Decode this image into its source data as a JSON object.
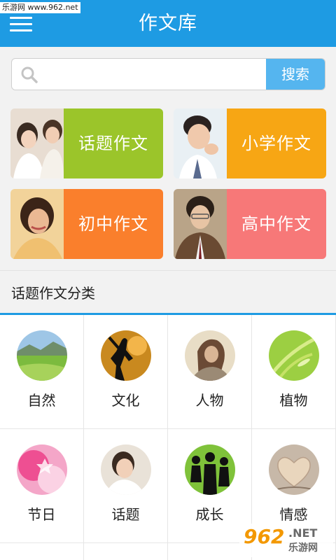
{
  "header": {
    "title": "作文库",
    "watermark_top": "乐游网 www.962.net",
    "menu_icon": "hamburger-menu-icon",
    "background": "#1e9be3"
  },
  "search": {
    "placeholder": "",
    "value": "",
    "button_label": "搜索",
    "icon": "search-icon",
    "button_color": "#55b5ef"
  },
  "categories": [
    {
      "label": "话题作文",
      "color": "#9bc52a"
    },
    {
      "label": "小学作文",
      "color": "#f7a614"
    },
    {
      "label": "初中作文",
      "color": "#fa7f2c"
    },
    {
      "label": "高中作文",
      "color": "#f77878"
    }
  ],
  "section": {
    "title": "话题作文分类"
  },
  "topics": [
    {
      "label": "自然"
    },
    {
      "label": "文化"
    },
    {
      "label": "人物"
    },
    {
      "label": "植物"
    },
    {
      "label": "节日"
    },
    {
      "label": "话题"
    },
    {
      "label": "成长"
    },
    {
      "label": "情感"
    }
  ],
  "watermark_bottom": {
    "number": "962",
    "net": ".NET",
    "site": "乐游网"
  }
}
